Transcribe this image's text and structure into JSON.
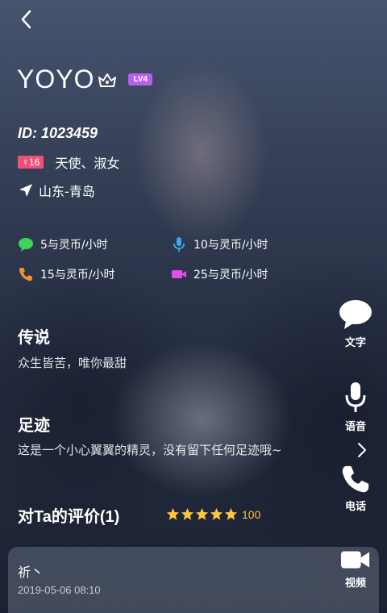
{
  "profile": {
    "name": "YOYO",
    "level": "LV4",
    "id": "ID: 1023459",
    "gender_age": "♀16",
    "tags": "天使、淑女",
    "location": "山东-青岛"
  },
  "rates": [
    {
      "icon": "chat-bubble-icon",
      "text": "5与灵币/小时",
      "color": "#3dd55a"
    },
    {
      "icon": "microphone-icon",
      "text": "10与灵币/小时",
      "color": "#3aa8f0"
    },
    {
      "icon": "phone-icon",
      "text": "15与灵币/小时",
      "color": "#f2922e"
    },
    {
      "icon": "video-camera-icon",
      "text": "25与灵币/小时",
      "color": "#e050e8"
    }
  ],
  "legend": {
    "title": "传说",
    "text": "众生皆苦，唯你最甜"
  },
  "footprint": {
    "title": "足迹",
    "text": "这是一个小心翼翼的精灵，没有留下任何足迹哦~"
  },
  "reviews": {
    "title": "对Ta的评价(1)",
    "stars": 5,
    "score": "100",
    "items": [
      {
        "user": "祈丶",
        "time": "2019-05-06 08:10"
      }
    ]
  },
  "actions": {
    "text": "文字",
    "voice": "语音",
    "call": "电话",
    "video": "视频"
  }
}
